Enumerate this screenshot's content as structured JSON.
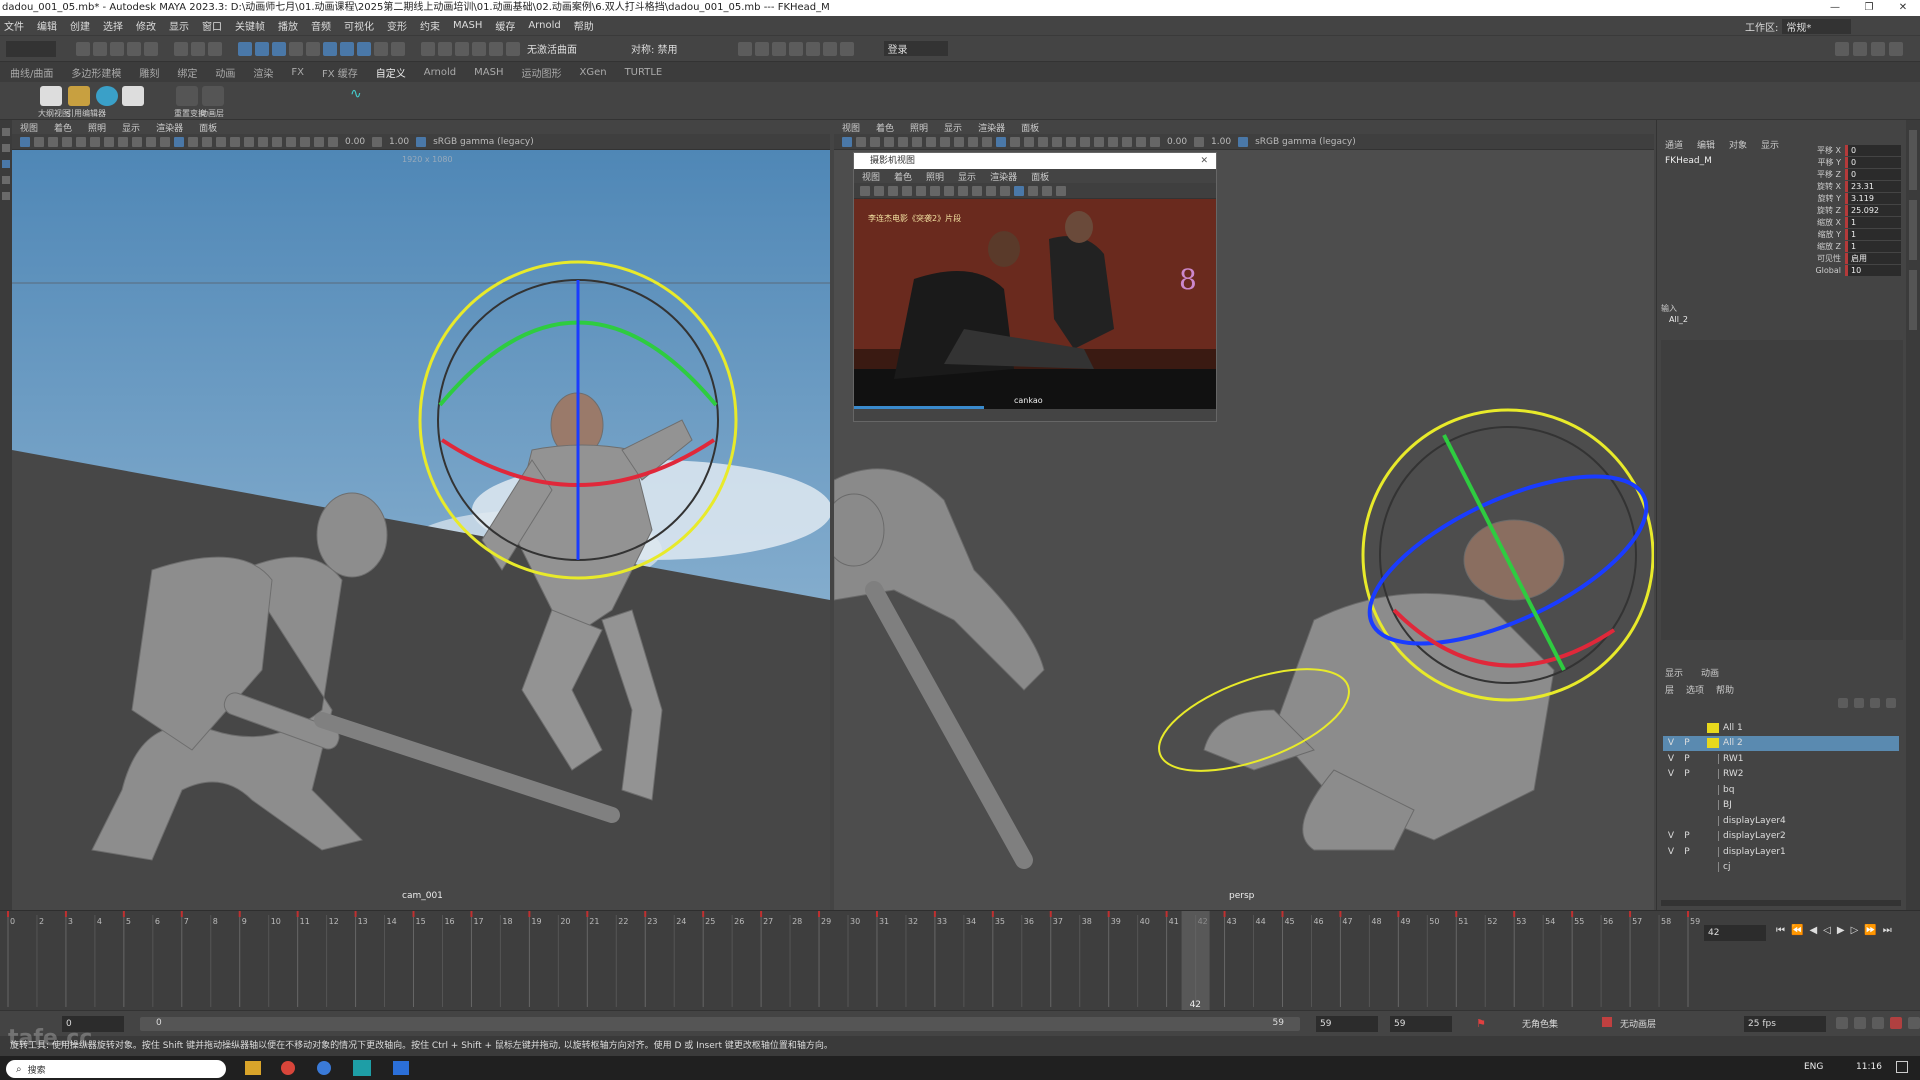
{
  "window": {
    "title": "dadou_001_05.mb* - Autodesk MAYA 2023.3: D:\\动画师七月\\01.动画课程\\2025第二期线上动画培训\\01.动画基础\\02.动画案例\\6.双人打斗格挡\\dadou_001_05.mb  ---  FKHead_M",
    "min": "—",
    "max": "❐",
    "close": "✕"
  },
  "menu": [
    "文件",
    "编辑",
    "创建",
    "选择",
    "修改",
    "显示",
    "窗口",
    "关键帧",
    "播放",
    "音频",
    "可视化",
    "变形",
    "约束",
    "MASH",
    "缓存",
    "Arnold",
    "帮助"
  ],
  "workspace": {
    "label": "工作区:",
    "value": "常规*"
  },
  "status": {
    "live": "无激活曲面",
    "symmetry": "对称: 禁用",
    "login": "登录"
  },
  "shelf_tabs": [
    "曲线/曲面",
    "多边形建模",
    "雕刻",
    "绑定",
    "动画",
    "渲染",
    "FX",
    "FX 缓存",
    "自定义",
    "Arnold",
    "MASH",
    "运动图形",
    "XGen",
    "TURTLE"
  ],
  "shelf_active": "自定义",
  "shelf_items": [
    "大纲视图",
    "引用编辑器",
    "",
    "",
    "重置变换",
    "动画层"
  ],
  "vp_menu": [
    "视图",
    "着色",
    "照明",
    "显示",
    "渲染器",
    "面板"
  ],
  "vp_left": {
    "val1": "0.00",
    "val2": "1.00",
    "color": "sRGB gamma (legacy)",
    "resolution": "1920 x 1080",
    "camera": "cam_001"
  },
  "vp_right": {
    "val1": "0.00",
    "val2": "1.00",
    "color": "sRGB gamma (legacy)",
    "camera": "persp"
  },
  "popup": {
    "title": "摄影机视图",
    "menu": [
      "视图",
      "着色",
      "照明",
      "显示",
      "渲染器",
      "面板"
    ],
    "subtitle": "李连杰电影《突袭2》片段",
    "camera": "cankao"
  },
  "channel": {
    "tabs": [
      "通道",
      "编辑",
      "对象",
      "显示"
    ],
    "object": "FKHead_M",
    "rows": [
      {
        "name": "平移 X",
        "value": "0"
      },
      {
        "name": "平移 Y",
        "value": "0"
      },
      {
        "name": "平移 Z",
        "value": "0"
      },
      {
        "name": "旋转 X",
        "value": "23.31"
      },
      {
        "name": "旋转 Y",
        "value": "3.119"
      },
      {
        "name": "旋转 Z",
        "value": "25.092"
      },
      {
        "name": "缩放 X",
        "value": "1"
      },
      {
        "name": "缩放 Y",
        "value": "1"
      },
      {
        "name": "缩放 Z",
        "value": "1"
      },
      {
        "name": "可见性",
        "value": "启用"
      },
      {
        "name": "Global",
        "value": "10"
      }
    ],
    "inputs_label": "输入",
    "inputs_item": "All_2"
  },
  "layers": {
    "tabs": [
      "显示",
      "动画"
    ],
    "menu": [
      "层",
      "选项",
      "帮助"
    ],
    "rows": [
      {
        "v": "",
        "p": "",
        "color": "#e8d81c",
        "name": "All 1"
      },
      {
        "v": "V",
        "p": "P",
        "color": "#e8d81c",
        "name": "All 2"
      },
      {
        "v": "V",
        "p": "P",
        "color": "",
        "name": "RW1"
      },
      {
        "v": "V",
        "p": "P",
        "color": "",
        "name": "RW2"
      },
      {
        "v": "",
        "p": "",
        "color": "",
        "name": "bq"
      },
      {
        "v": "",
        "p": "",
        "color": "",
        "name": "BJ"
      },
      {
        "v": "",
        "p": "",
        "color": "",
        "name": "displayLayer4"
      },
      {
        "v": "V",
        "p": "P",
        "color": "",
        "name": "displayLayer2"
      },
      {
        "v": "V",
        "p": "P",
        "color": "",
        "name": "displayLayer1"
      },
      {
        "v": "",
        "p": "",
        "color": "",
        "name": "cj"
      }
    ]
  },
  "timeline": {
    "ticks": [
      "0",
      "2",
      "3",
      "4",
      "5",
      "6",
      "7",
      "8",
      "9",
      "10",
      "11",
      "12",
      "13",
      "14",
      "15",
      "16",
      "17",
      "18",
      "19",
      "20",
      "21",
      "22",
      "23",
      "24",
      "25",
      "26",
      "27",
      "28",
      "29",
      "30",
      "31",
      "32",
      "33",
      "34",
      "35",
      "36",
      "37",
      "38",
      "39",
      "40",
      "41",
      "42",
      "43",
      "44",
      "45",
      "46",
      "47",
      "48",
      "49",
      "50",
      "51",
      "52",
      "53",
      "54",
      "55",
      "56",
      "57",
      "58",
      "59"
    ],
    "current": "42",
    "current_field": "42"
  },
  "range": {
    "start": "0",
    "inner_start": "0",
    "inner_end": "59",
    "end1": "59",
    "end2": "59",
    "char_set": "无角色集",
    "anim_layer": "无动画层",
    "fps": "25 fps"
  },
  "help": "旋转工具: 使用操纵器旋转对象。按住 Shift 键并拖动操纵器轴以便在不移动对象的情况下更改轴向。按住 Ctrl + Shift + 鼠标左键并拖动, 以旋转枢轴方向对齐。使用 D 或 Insert 键更改枢轴位置和轴方向。",
  "taskbar": {
    "search": "搜索",
    "time": "11:16",
    "lang": "ENG"
  },
  "watermark": "tafe.cc"
}
